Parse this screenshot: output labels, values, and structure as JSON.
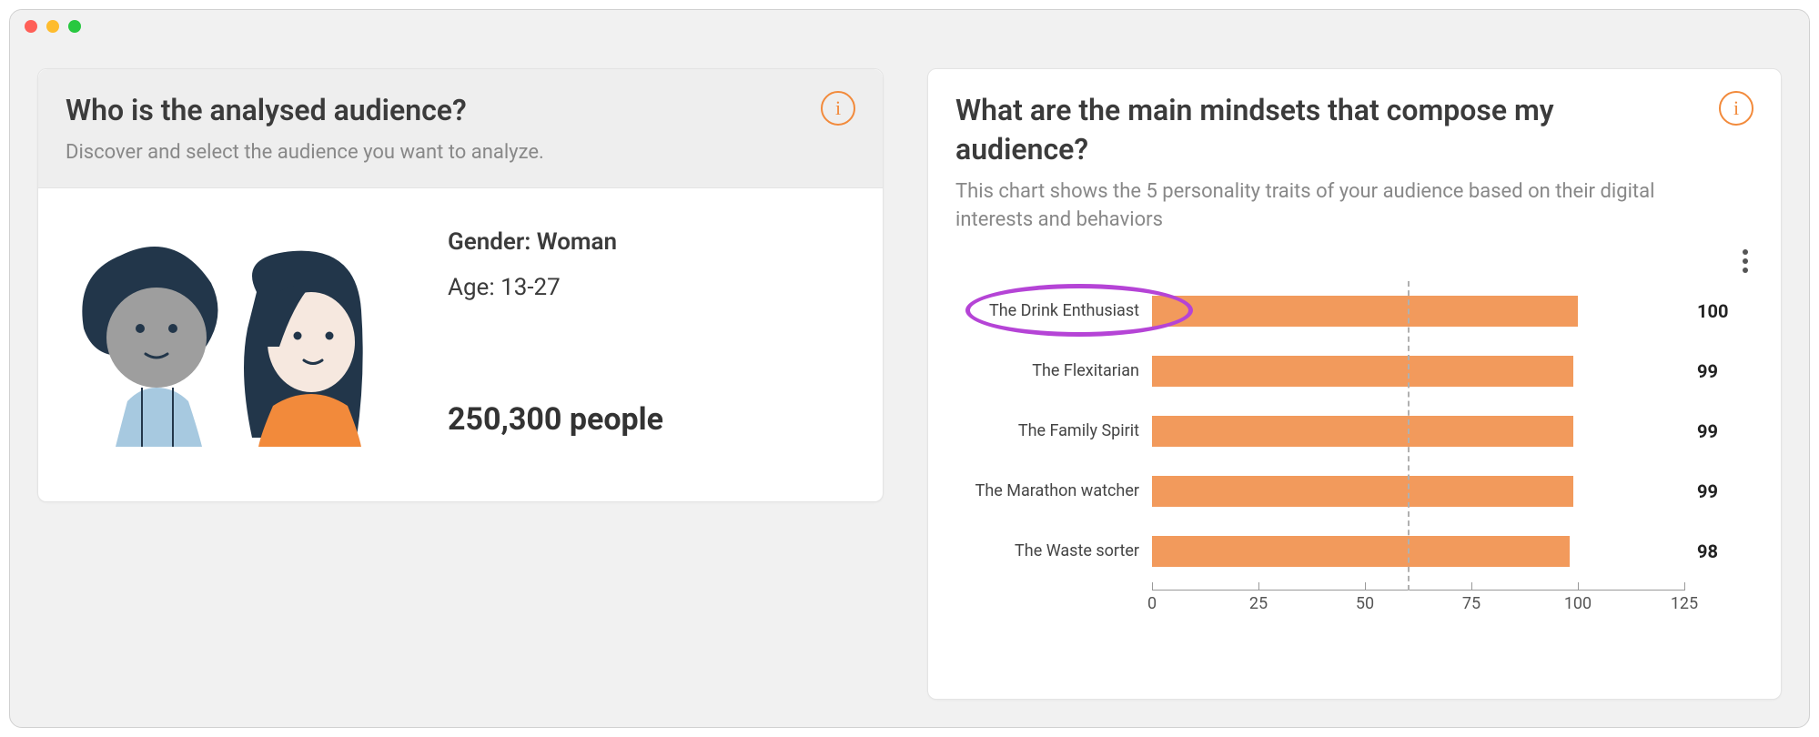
{
  "leftCard": {
    "title": "Who is the analysed audience?",
    "subtitle": "Discover and select the audience you want to analyze.",
    "genderLabel": "Gender:",
    "genderValue": "Woman",
    "ageLabel": "Age:",
    "ageValue": "13-27",
    "countValue": "250,300",
    "countSuffix": "people"
  },
  "rightCard": {
    "title": "What are the main mindsets that compose my audience?",
    "subtitle": "This chart shows the 5 personality traits of your audience based on their digital interests and behaviors"
  },
  "chart_data": {
    "type": "bar",
    "orientation": "horizontal",
    "title": "",
    "xlabel": "",
    "ylabel": "",
    "xlim": [
      0,
      125
    ],
    "ticks": [
      0,
      25,
      50,
      75,
      100,
      125
    ],
    "reference_line": 60,
    "categories": [
      "The Drink Enthusiast",
      "The Flexitarian",
      "The Family Spirit",
      "The Marathon watcher",
      "The Waste sorter"
    ],
    "values": [
      100,
      99,
      99,
      99,
      98
    ],
    "highlighted_category": "The Drink Enthusiast",
    "bar_color": "#f29a5c"
  }
}
